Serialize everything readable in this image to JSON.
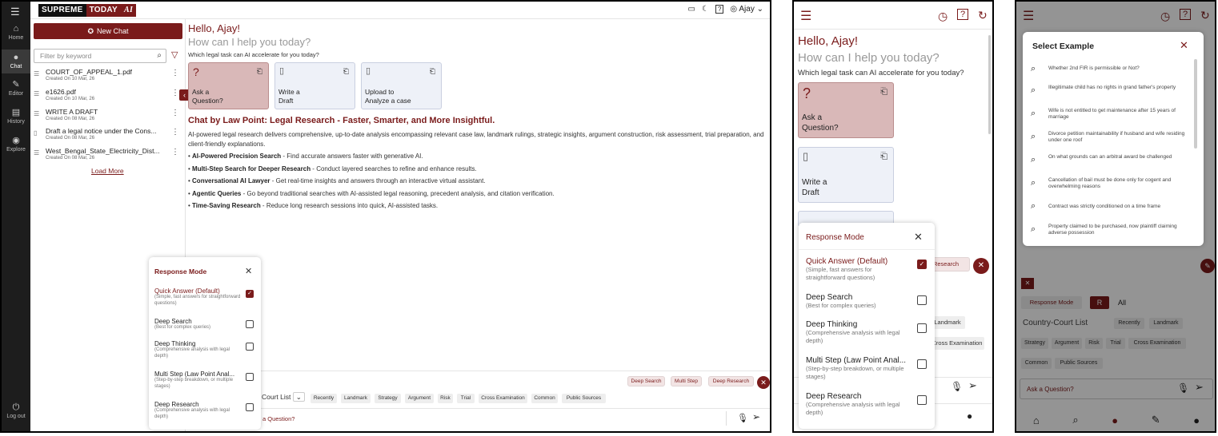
{
  "app": {
    "brand_1": "SUPREME",
    "brand_2": "TODAY",
    "brand_3": "AI",
    "user": "Ajay"
  },
  "rail": [
    {
      "label": "Home",
      "icon": "home-icon"
    },
    {
      "label": "Chat",
      "icon": "chat-icon"
    },
    {
      "label": "Editor",
      "icon": "editor-icon"
    },
    {
      "label": "History",
      "icon": "history-icon"
    },
    {
      "label": "Explore",
      "icon": "explore-icon"
    },
    {
      "label": "Log out",
      "icon": "logout-icon"
    }
  ],
  "sidebar": {
    "new_chat": "New Chat",
    "filter_placeholder": "Filter by keyword",
    "history": [
      {
        "title": "COURT_OF_APPEAL_1.pdf",
        "date": "Created On 10 Mar, 26"
      },
      {
        "title": "e1626.pdf",
        "date": "Created On 10 Mar, 26"
      },
      {
        "title": "WRITE A DRAFT",
        "date": "Created On 08 Mar, 26"
      },
      {
        "title": "Draft a legal notice under the Cons...",
        "date": "Created On 08 Mar, 26"
      },
      {
        "title": "West_Bengal_State_Electricity_Dist...",
        "date": "Created On 08 Mar, 26"
      }
    ],
    "load_more": "Load More"
  },
  "main": {
    "hello": "Hello, Ajay!",
    "how": "How can I help you today?",
    "which": "Which legal task can AI accelerate for you today?",
    "cards": [
      {
        "l1": "Ask a",
        "l2": "Question?"
      },
      {
        "l1": "Write a",
        "l2": "Draft"
      },
      {
        "l1": "Upload to",
        "l2": "Analyze a case"
      }
    ],
    "heading": "Chat by Law Point: Legal Research - Faster, Smarter, and More Insightful.",
    "para": "AI-powered legal research delivers comprehensive, up-to-date analysis encompassing relevant case law, landmark rulings, strategic insights, argument construction, risk assessment, trial preparation, and client-friendly explanations.",
    "bullets": [
      {
        "b": "AI-Powered Precision Search",
        "t": " - Find accurate answers faster with generative AI."
      },
      {
        "b": "Multi-Step Search for Deeper Research",
        "t": " - Conduct layered searches to refine and enhance results."
      },
      {
        "b": "Conversational AI Lawyer",
        "t": " - Get real-time insights and answers through an interactive virtual assistant."
      },
      {
        "b": "Agentic Queries",
        "t": " - Go beyond traditional searches with AI-assisted legal reasoning, precedent analysis, and citation verification."
      },
      {
        "b": "Time-Saving Research",
        "t": " - Reduce long research sessions into quick, AI-assisted tasks."
      }
    ],
    "chips": [
      "Deep Search",
      "Multi Step",
      "Deep Research"
    ],
    "court_list": "Court List",
    "tags": [
      "Recently",
      "Landmark",
      "Strategy",
      "Argument",
      "Risk",
      "Trial",
      "Cross Examination",
      "Common",
      "Public Sources"
    ],
    "input_placeholder": "a Question?"
  },
  "response_mode": {
    "title": "Response Mode",
    "options": [
      {
        "name": "Quick Answer (Default)",
        "sub": "(Simple, fast answers for straightforward questions)",
        "checked": true
      },
      {
        "name": "Deep Search",
        "sub": "(Best for complex queries)",
        "checked": false
      },
      {
        "name": "Deep Thinking",
        "sub": "(Comprehensive analysis with legal depth)",
        "checked": false
      },
      {
        "name": "Multi Step (Law Point Anal...",
        "sub": "(Step-by-step breakdown, or multiple stages)",
        "checked": false
      },
      {
        "name": "Deep Research",
        "sub": "(Comprehensive analysis with legal depth)",
        "checked": false
      }
    ]
  },
  "mobile2": {
    "hello": "Hello, Ajay!",
    "how": "How can I help you today?",
    "which": "Which legal task can AI accelerate for you today?",
    "card1": {
      "l1": "Ask a",
      "l2": "Question?"
    },
    "card2": {
      "l1": "Write a",
      "l2": "Draft"
    },
    "research_chip": "Research",
    "tag1": "Landmark",
    "tag2": "Cross Examination"
  },
  "mobile3": {
    "title": "Select Example",
    "examples": [
      "Whether 2nd FIR is permissible or Not?",
      "Illegitimate child has no rights in grand father's property",
      "Wife is not entitled to get maintenance after 15 years of marriage",
      "Divorce petition maintainability if husband and wife residing under one roof",
      "On what grounds can an arbitral award be challenged",
      "Cancellation of bail must be done only for cogent and overwhelming reasons",
      "Contract was strictly conditioned on a time frame",
      "Property claimed to be purchased, now plaintiff claiming adverse possession"
    ],
    "response_mode": "Response Mode",
    "r": "R",
    "all": "All",
    "court_list": "Country-Court List",
    "tags1": [
      "Recently",
      "Landmark"
    ],
    "tags2": [
      "Strategy",
      "Argument",
      "Risk",
      "Trial",
      "Cross Examination"
    ],
    "tags3": [
      "Common",
      "Public Sources"
    ],
    "input_placeholder": "Ask a Question?"
  }
}
